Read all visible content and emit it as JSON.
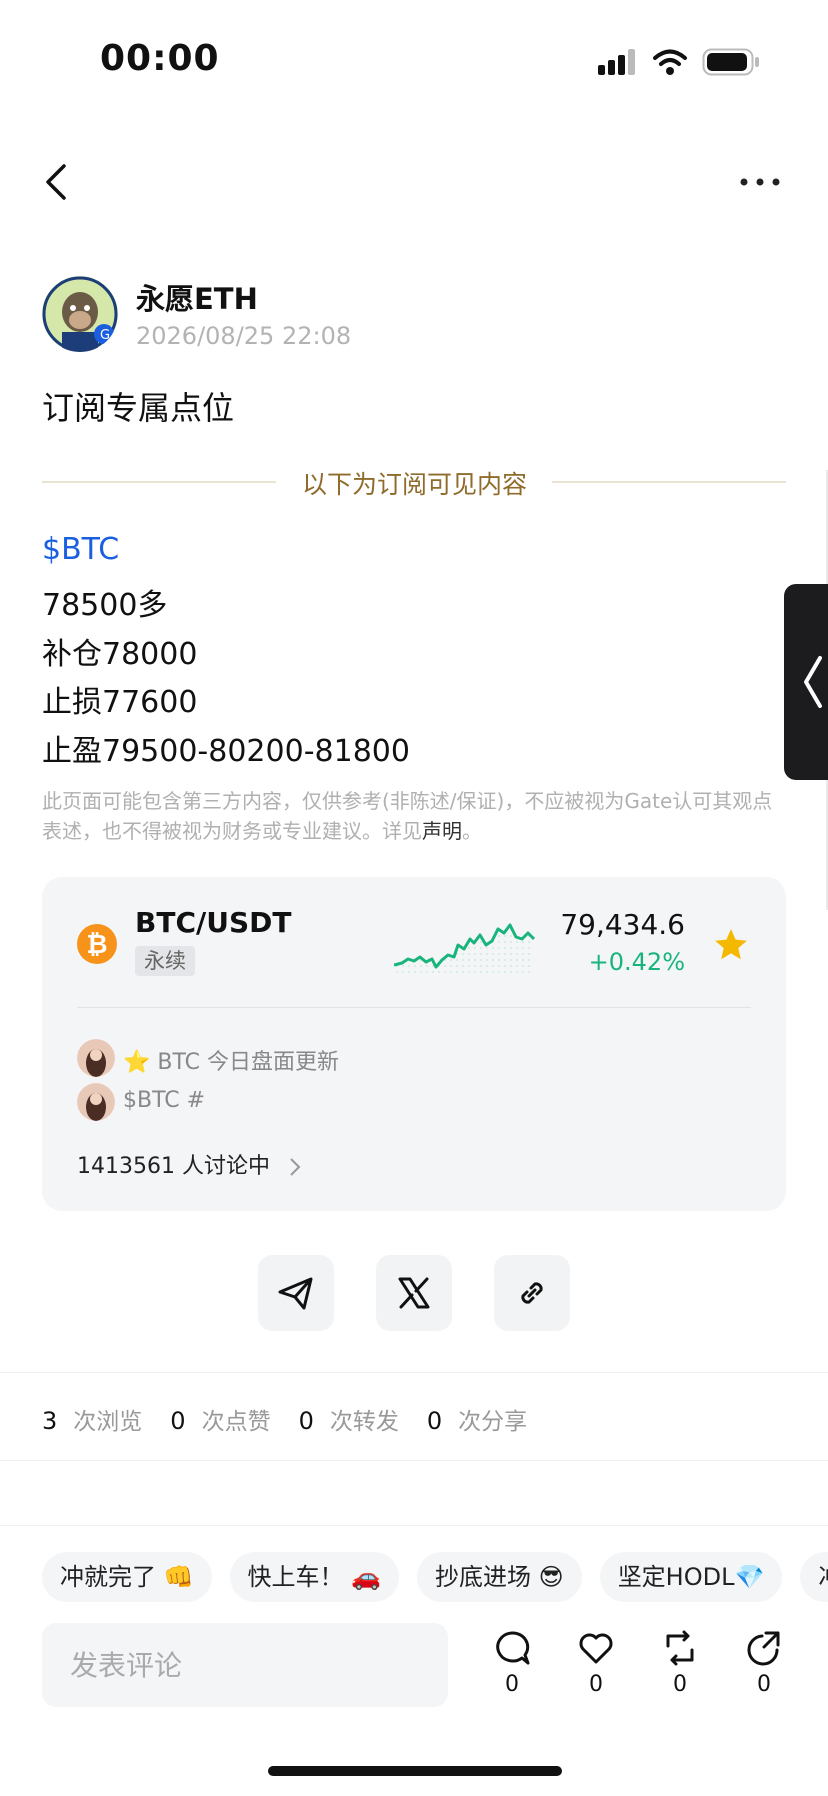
{
  "status_bar": {
    "time": "00:00"
  },
  "post": {
    "author": "永愿ETH",
    "date": "2026/08/25 22:08",
    "title": "订阅专属点位",
    "divider_label": "以下为订阅可见内容",
    "lines": [
      "$BTC",
      "78500多",
      "补仓78000",
      "止损77600",
      "止盈79500-80200-81800"
    ],
    "disclaimer_text": "此页面可能包含第三方内容，仅供参考(非陈述/保证)，不应被视为Gate认可其观点表述，也不得被视为财务或专业建议。详见",
    "disclaimer_link": "声明",
    "disclaimer_end": "。"
  },
  "market": {
    "coin_symbol": "₿",
    "pair": "BTC/USDT",
    "tag": "永续",
    "price": "79,434.6",
    "change": "+0.42%",
    "colors": {
      "up": "#19b47c",
      "coin": "#f7931a",
      "star": "#f5b800"
    },
    "topics": [
      "⭐️ BTC 今日盘面更新",
      "$BTC #"
    ],
    "discussion": "1413561 人讨论中"
  },
  "stats": [
    {
      "count": "3",
      "label": "次浏览"
    },
    {
      "count": "0",
      "label": "次点赞"
    },
    {
      "count": "0",
      "label": "次转发"
    },
    {
      "count": "0",
      "label": "次分享"
    }
  ],
  "chips": [
    "冲就完了 👊",
    "快上车！ 🚗",
    "抄底进场 😎",
    "坚定HODL💎",
    "冲"
  ],
  "comment": {
    "placeholder": "发表评论",
    "counts": {
      "comment": "0",
      "like": "0",
      "repost": "0",
      "share": "0"
    }
  }
}
